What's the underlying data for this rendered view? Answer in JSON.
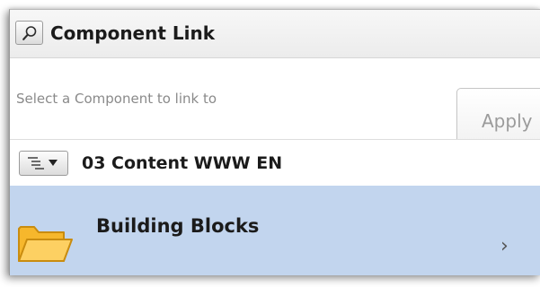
{
  "header": {
    "title": "Component Link",
    "search_icon": "magnifier-icon"
  },
  "link": {
    "placeholder": "Select a Component to link to",
    "value": "",
    "apply_label": "Apply"
  },
  "path": {
    "title": "03 Content WWW EN",
    "toggle_icon": "tree-view-dropdown-icon"
  },
  "items": [
    {
      "label": "Building Blocks",
      "icon": "folder-icon",
      "selected": true,
      "chevron": "›"
    }
  ],
  "colors": {
    "selected_row": "#c2d5ee",
    "folder_fill": "#fcc537",
    "folder_stroke": "#d49a12"
  }
}
